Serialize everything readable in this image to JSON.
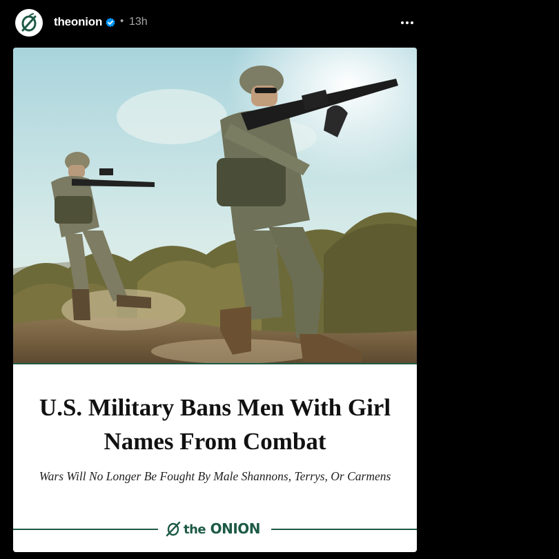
{
  "post": {
    "username": "theonion",
    "verified_icon": "verified-badge-icon",
    "separator": "•",
    "timestamp": "13h",
    "more_icon": "more-options-icon",
    "avatar_icon": "onion-logo-icon"
  },
  "article": {
    "image_icon": "soldiers-photo",
    "headline": "U.S. Military Bans Men With Girl Names From Combat",
    "subhead": "Wars Will No Longer Be Fought By Male Shannons, Terrys, Or Carmens",
    "logo_the": "the",
    "logo_onion": "ONION"
  },
  "colors": {
    "background": "#000000",
    "card": "#ffffff",
    "brand_green": "#1d5a45",
    "verified_blue": "#0095f6"
  }
}
